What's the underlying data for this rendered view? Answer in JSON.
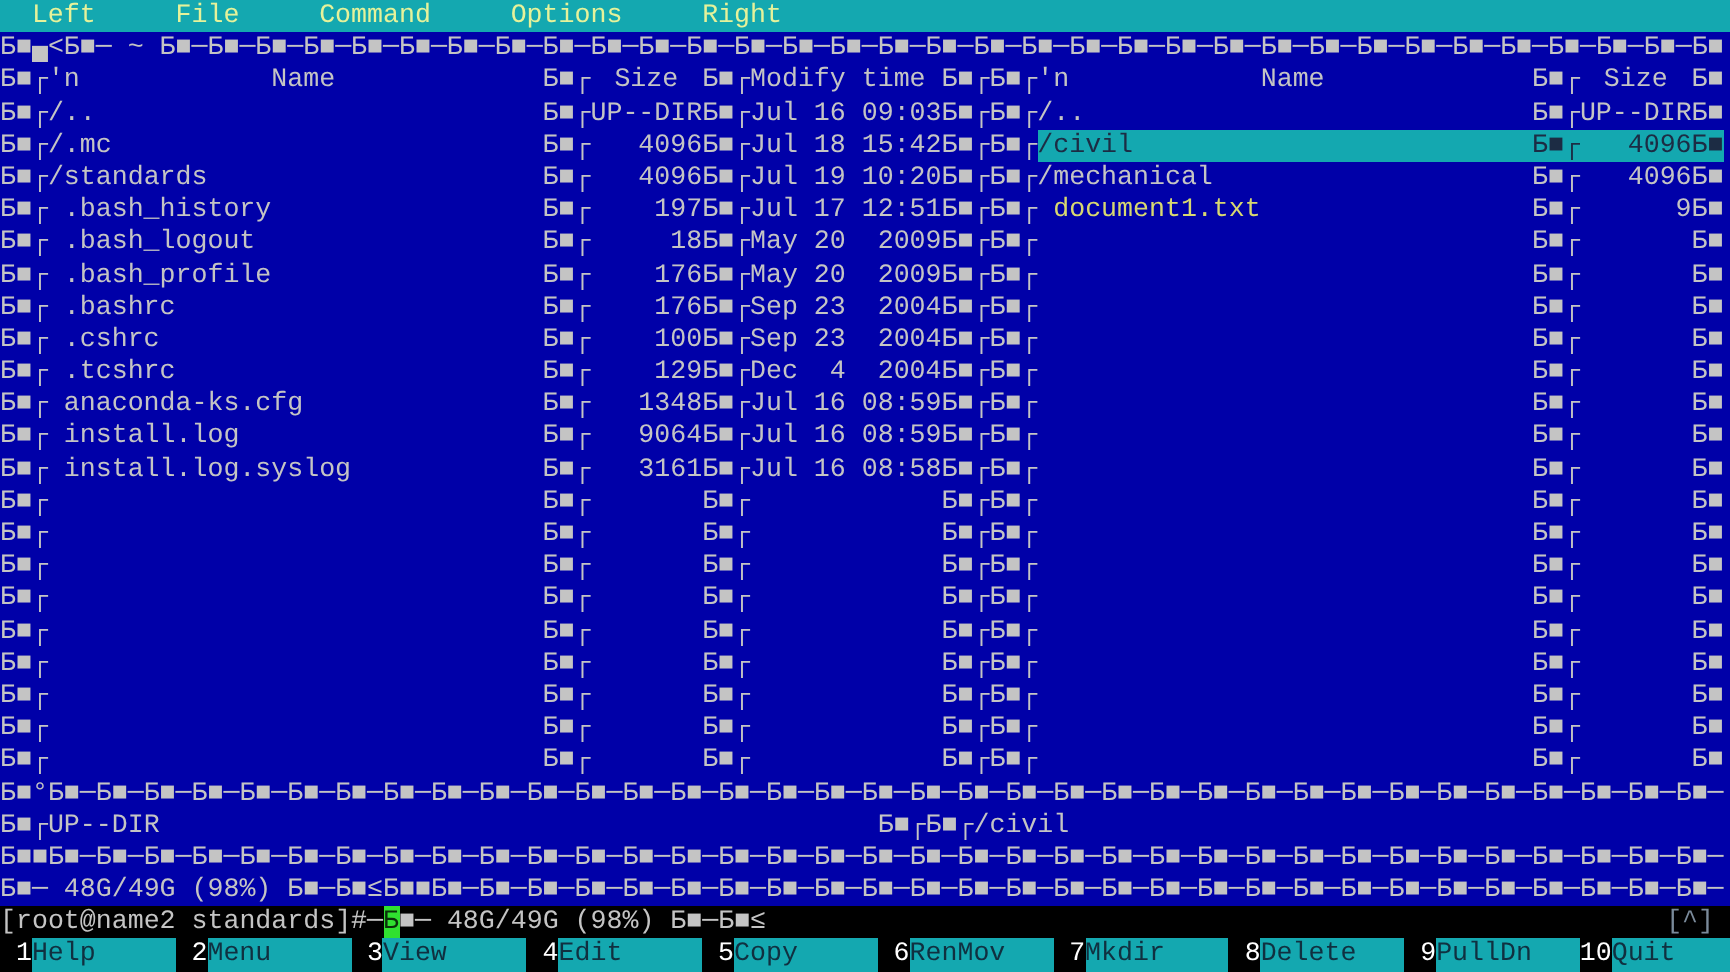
{
  "menu": [
    "Left",
    "File",
    "Command",
    "Options",
    "Right"
  ],
  "top_border": "Б■▄<Б■─ ~ Б■─Б■─Б■─Б■─Б■─Б■─Б■─Б■─Б■─Б■─Б■─Б■─Б■─Б■─Б■─Б■─Б■─Б■─Б■─Б■─Б■─Б■─Б■─Б■─Б■─Б■─Б■─Б■─Б■─Б■─Б■─Б■─Б■",
  "header": {
    "left": {
      "marks": [
        "Б■┌",
        "Б■┌",
        "Б■┌",
        "Б■┌"
      ],
      "type": "'n",
      "name": "Name",
      "size": "Size",
      "modify": "Modify time"
    },
    "right": {
      "marks": [
        "Б■┌",
        "Б■┌",
        "Б■"
      ],
      "type": "'n",
      "name": "Name",
      "size": "Size"
    }
  },
  "rows": [
    {
      "left": {
        "marks": [
          "Б■┌",
          "Б■┌",
          "Б■┌",
          "Б■┌"
        ],
        "kind": "dir",
        "name": "/..",
        "size": "UP--DIR",
        "modify": "Jul 16 09:03"
      },
      "right": {
        "marks": [
          "Б■┌",
          "Б■┌",
          "Б■"
        ],
        "kind": "dir",
        "name": "/..",
        "size": "UP--DIR",
        "selected": false
      }
    },
    {
      "left": {
        "marks": [
          "Б■┌",
          "Б■┌",
          "Б■┌",
          "Б■┌"
        ],
        "kind": "dir",
        "name": "/.mc",
        "size": "4096",
        "modify": "Jul 18 15:42"
      },
      "right": {
        "marks": [
          "Б■┌",
          "Б■┌",
          "Б■"
        ],
        "kind": "dir",
        "name": "/civil",
        "size": "4096",
        "selected": true
      }
    },
    {
      "left": {
        "marks": [
          "Б■┌",
          "Б■┌",
          "Б■┌",
          "Б■┌"
        ],
        "kind": "dir",
        "name": "/standards",
        "size": "4096",
        "modify": "Jul 19 10:20"
      },
      "right": {
        "marks": [
          "Б■┌",
          "Б■┌",
          "Б■"
        ],
        "kind": "dir",
        "name": "/mechanical",
        "size": "4096",
        "selected": false
      }
    },
    {
      "left": {
        "marks": [
          "Б■┌",
          "Б■┌",
          "Б■┌",
          "Б■┌"
        ],
        "kind": "file",
        "name": ".bash_history",
        "size": "197",
        "modify": "Jul 17 12:51"
      },
      "right": {
        "marks": [
          "Б■┌",
          "Б■┌",
          "Б■"
        ],
        "kind": "text",
        "name": "document1.txt",
        "size": "9",
        "selected": false
      }
    },
    {
      "left": {
        "marks": [
          "Б■┌",
          "Б■┌",
          "Б■┌",
          "Б■┌"
        ],
        "kind": "file",
        "name": ".bash_logout",
        "size": "18",
        "modify": "May 20  2009"
      },
      "right": {
        "marks": [
          "Б■┌",
          "Б■┌",
          "Б■"
        ]
      }
    },
    {
      "left": {
        "marks": [
          "Б■┌",
          "Б■┌",
          "Б■┌",
          "Б■┌"
        ],
        "kind": "file",
        "name": ".bash_profile",
        "size": "176",
        "modify": "May 20  2009"
      },
      "right": {
        "marks": [
          "Б■┌",
          "Б■┌",
          "Б■"
        ]
      }
    },
    {
      "left": {
        "marks": [
          "Б■┌",
          "Б■┌",
          "Б■┌",
          "Б■┌"
        ],
        "kind": "file",
        "name": ".bashrc",
        "size": "176",
        "modify": "Sep 23  2004"
      },
      "right": {
        "marks": [
          "Б■┌",
          "Б■┌",
          "Б■"
        ]
      }
    },
    {
      "left": {
        "marks": [
          "Б■┌",
          "Б■┌",
          "Б■┌",
          "Б■┌"
        ],
        "kind": "file",
        "name": ".cshrc",
        "size": "100",
        "modify": "Sep 23  2004"
      },
      "right": {
        "marks": [
          "Б■┌",
          "Б■┌",
          "Б■"
        ]
      }
    },
    {
      "left": {
        "marks": [
          "Б■┌",
          "Б■┌",
          "Б■┌",
          "Б■┌"
        ],
        "kind": "file",
        "name": ".tcshrc",
        "size": "129",
        "modify": "Dec  4  2004"
      },
      "right": {
        "marks": [
          "Б■┌",
          "Б■┌",
          "Б■"
        ]
      }
    },
    {
      "left": {
        "marks": [
          "Б■┌",
          "Б■┌",
          "Б■┌",
          "Б■┌"
        ],
        "kind": "file",
        "name": "anaconda-ks.cfg",
        "size": "1348",
        "modify": "Jul 16 08:59"
      },
      "right": {
        "marks": [
          "Б■┌",
          "Б■┌",
          "Б■"
        ]
      }
    },
    {
      "left": {
        "marks": [
          "Б■┌",
          "Б■┌",
          "Б■┌",
          "Б■┌"
        ],
        "kind": "file",
        "name": "install.log",
        "size": "9064",
        "modify": "Jul 16 08:59"
      },
      "right": {
        "marks": [
          "Б■┌",
          "Б■┌",
          "Б■"
        ]
      }
    },
    {
      "left": {
        "marks": [
          "Б■┌",
          "Б■┌",
          "Б■┌",
          "Б■┌"
        ],
        "kind": "file",
        "name": "install.log.syslog",
        "size": "3161",
        "modify": "Jul 16 08:58"
      },
      "right": {
        "marks": [
          "Б■┌",
          "Б■┌",
          "Б■"
        ]
      }
    },
    {
      "left": {
        "marks": [
          "Б■┌",
          "Б■┌",
          "Б■┌",
          "Б■┌"
        ]
      },
      "right": {
        "marks": [
          "Б■┌",
          "Б■┌",
          "Б■"
        ]
      }
    },
    {
      "left": {
        "marks": [
          "Б■┌",
          "Б■┌",
          "Б■┌",
          "Б■┌"
        ]
      },
      "right": {
        "marks": [
          "Б■┌",
          "Б■┌",
          "Б■"
        ]
      }
    },
    {
      "left": {
        "marks": [
          "Б■┌",
          "Б■┌",
          "Б■┌",
          "Б■┌"
        ]
      },
      "right": {
        "marks": [
          "Б■┌",
          "Б■┌",
          "Б■"
        ]
      }
    },
    {
      "left": {
        "marks": [
          "Б■┌",
          "Б■┌",
          "Б■┌",
          "Б■┌"
        ]
      },
      "right": {
        "marks": [
          "Б■┌",
          "Б■┌",
          "Б■"
        ]
      }
    },
    {
      "left": {
        "marks": [
          "Б■┌",
          "Б■┌",
          "Б■┌",
          "Б■┌"
        ]
      },
      "right": {
        "marks": [
          "Б■┌",
          "Б■┌",
          "Б■"
        ]
      }
    },
    {
      "left": {
        "marks": [
          "Б■┌",
          "Б■┌",
          "Б■┌",
          "Б■┌"
        ]
      },
      "right": {
        "marks": [
          "Б■┌",
          "Б■┌",
          "Б■"
        ]
      }
    },
    {
      "left": {
        "marks": [
          "Б■┌",
          "Б■┌",
          "Б■┌",
          "Б■┌"
        ]
      },
      "right": {
        "marks": [
          "Б■┌",
          "Б■┌",
          "Б■"
        ]
      }
    },
    {
      "left": {
        "marks": [
          "Б■┌",
          "Б■┌",
          "Б■┌",
          "Б■┌"
        ]
      },
      "right": {
        "marks": [
          "Б■┌",
          "Б■┌",
          "Б■"
        ]
      }
    },
    {
      "left": {
        "marks": [
          "Б■┌",
          "Б■┌",
          "Б■┌",
          "Б■┌"
        ]
      },
      "right": {
        "marks": [
          "Б■┌",
          "Б■┌",
          "Б■"
        ]
      }
    }
  ],
  "bottom_border": "Б■°Б■─Б■─Б■─Б■─Б■─Б■─Б■─Б■─Б■─Б■─Б■─Б■─Б■─Б■─Б■─Б■─Б■─Б■─Б■─Б■─Б■─Б■─Б■─Б■─Б■─Б■─Б■─Б■─Б■─Б■─Б■─Б■─Б■─Б■─Б■─",
  "mini_status": {
    "left": "Б■┌UP--DIR",
    "right": "Б■┌Б■┌/civil"
  },
  "separator_line": "Б■■Б■─Б■─Б■─Б■─Б■─Б■─Б■─Б■─Б■─Б■─Б■─Б■─Б■─Б■─Б■─Б■─Б■─Б■─Б■─Б■─Б■─Б■─Б■─Б■─Б■─Б■─Б■─Б■─Б■─Б■─Б■─Б■─Б■─Б■─Б■─",
  "disk_line": "Б■─ 48G/49G (98%) Б■─Б■≤Б■■Б■─Б■─Б■─Б■─Б■─Б■─Б■─Б■─Б■─Б■─Б■─Б■─Б■─Б■─Б■─Б■─Б■─Б■─Б■─Б■─Б■─Б■─Б■─Б■─Б■─Б■─Б■─",
  "prompt": {
    "text": "[root@name2 standards]#─",
    "cursor": "Б",
    "rest": "■─ 48G/49G (98%) Б■─Б■≤",
    "scroll_hint": "[^]"
  },
  "function_keys": [
    {
      "number": "1",
      "label": "Help"
    },
    {
      "number": "2",
      "label": "Menu"
    },
    {
      "number": "3",
      "label": "View"
    },
    {
      "number": "4",
      "label": "Edit"
    },
    {
      "number": "5",
      "label": "Copy"
    },
    {
      "number": "6",
      "label": "RenMov"
    },
    {
      "number": "7",
      "label": "Mkdir"
    },
    {
      "number": "8",
      "label": "Delete"
    },
    {
      "number": "9",
      "label": "PullDn"
    },
    {
      "number": "10",
      "label": "Quit"
    }
  ]
}
